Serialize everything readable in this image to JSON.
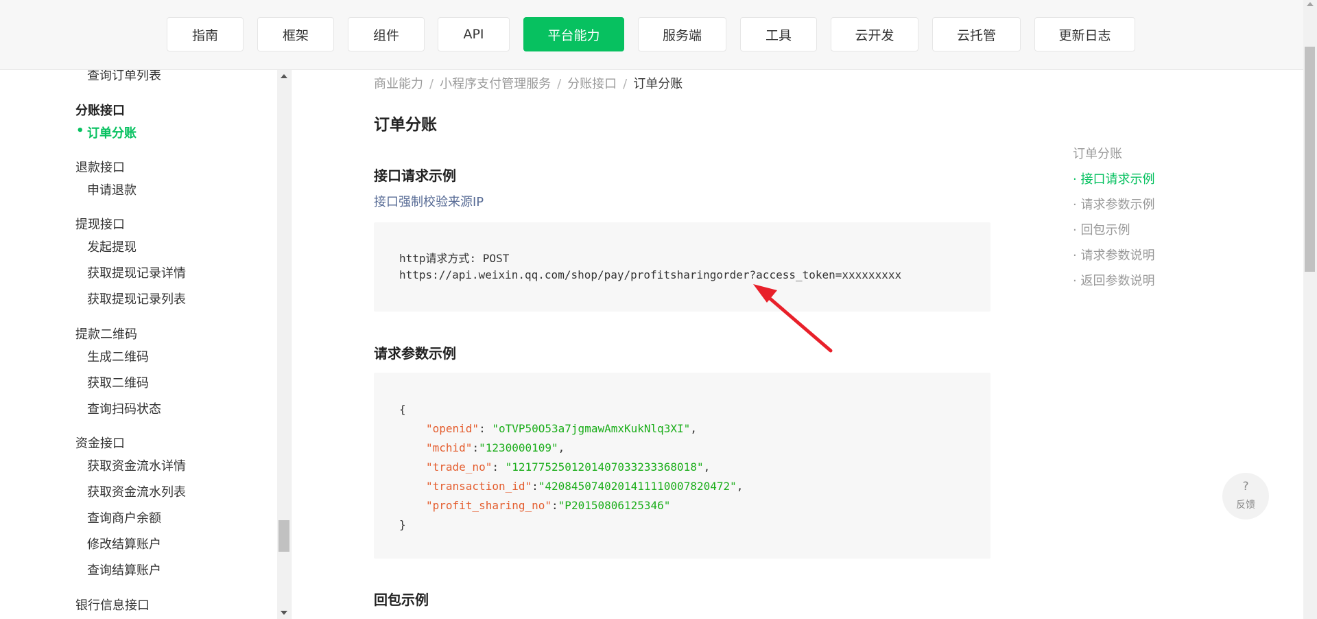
{
  "nav": {
    "tabs": [
      {
        "label": "指南"
      },
      {
        "label": "框架"
      },
      {
        "label": "组件"
      },
      {
        "label": "API"
      },
      {
        "label": "平台能力"
      },
      {
        "label": "服务端"
      },
      {
        "label": "工具"
      },
      {
        "label": "云开发"
      },
      {
        "label": "云托管"
      },
      {
        "label": "更新日志"
      }
    ],
    "active_tab": "平台能力"
  },
  "sidebar": {
    "items": [
      {
        "label": "查询订单列表"
      },
      {
        "label": "分账接口"
      },
      {
        "label": "订单分账"
      },
      {
        "label": "退款接口"
      },
      {
        "label": "申请退款"
      },
      {
        "label": "提现接口"
      },
      {
        "label": "发起提现"
      },
      {
        "label": "获取提现记录详情"
      },
      {
        "label": "获取提现记录列表"
      },
      {
        "label": "提款二维码"
      },
      {
        "label": "生成二维码"
      },
      {
        "label": "获取二维码"
      },
      {
        "label": "查询扫码状态"
      },
      {
        "label": "资金接口"
      },
      {
        "label": "获取资金流水详情"
      },
      {
        "label": "获取资金流水列表"
      },
      {
        "label": "查询商户余额"
      },
      {
        "label": "修改结算账户"
      },
      {
        "label": "查询结算账户"
      },
      {
        "label": "银行信息接口"
      }
    ],
    "active_item": "订单分账"
  },
  "breadcrumb": {
    "items": [
      "商业能力",
      "小程序支付管理服务",
      "分账接口",
      "订单分账"
    ],
    "separator": "/"
  },
  "main": {
    "title": "订单分账",
    "section_request": "接口请求示例",
    "ip_link": "接口强制校验来源IP",
    "request_method_line": "http请求方式: POST",
    "request_url_line": "https://api.weixin.qq.com/shop/pay/profitsharingorder?access_token=xxxxxxxxx",
    "section_params": "请求参数示例",
    "params_code": {
      "open_brace": "{",
      "close_brace": "}",
      "fields": [
        {
          "key": "\"openid\"",
          "sep": ": ",
          "value": "\"oTVP50O53a7jgmawAmxKukNlq3XI\"",
          "tail": ","
        },
        {
          "key": "\"mchid\"",
          "sep": ":",
          "value": "\"1230000109\"",
          "tail": ","
        },
        {
          "key": "\"trade_no\"",
          "sep": ": ",
          "value": "\"1217752501201407033233368018\"",
          "tail": ","
        },
        {
          "key": "\"transaction_id\"",
          "sep": ":",
          "value": "\"4208450740201411110007820472\"",
          "tail": ","
        },
        {
          "key": "\"profit_sharing_no\"",
          "sep": ":",
          "value": "\"P20150806125346\"",
          "tail": ""
        }
      ]
    },
    "section_response": "回包示例"
  },
  "toc": {
    "items": [
      {
        "label": "订单分账"
      },
      {
        "label": "· 接口请求示例"
      },
      {
        "label": "· 请求参数示例"
      },
      {
        "label": "· 回包示例"
      },
      {
        "label": "· 请求参数说明"
      },
      {
        "label": "· 返回参数说明"
      }
    ],
    "active_item": "· 接口请求示例"
  },
  "feedback": {
    "icon": "?",
    "label": "反馈"
  },
  "colors": {
    "brand_green": "#07c160",
    "link_blue": "#576b95",
    "json_key": "#e45d2e",
    "json_string": "#1aad19",
    "annotation_arrow": "#e8202a"
  }
}
